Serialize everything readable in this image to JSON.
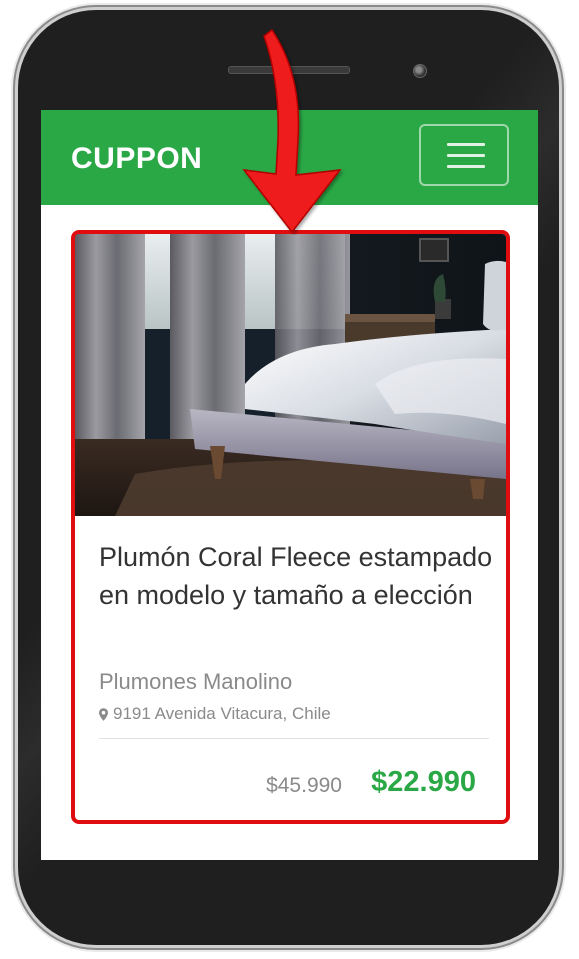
{
  "navbar": {
    "brand": "CUPPON",
    "menu_icon": "hamburger-menu-icon",
    "color": "#2aa846"
  },
  "deal": {
    "title": "Plumón Coral Fleece estampado en modelo y tamaño a elección",
    "merchant": "Plumones Manolino",
    "address": "9191 Avenida Vitacura, Chile",
    "address_icon": "map-pin-icon",
    "original_price": "$45.990",
    "price": "$22.990"
  },
  "highlight_color": "#e00d10"
}
